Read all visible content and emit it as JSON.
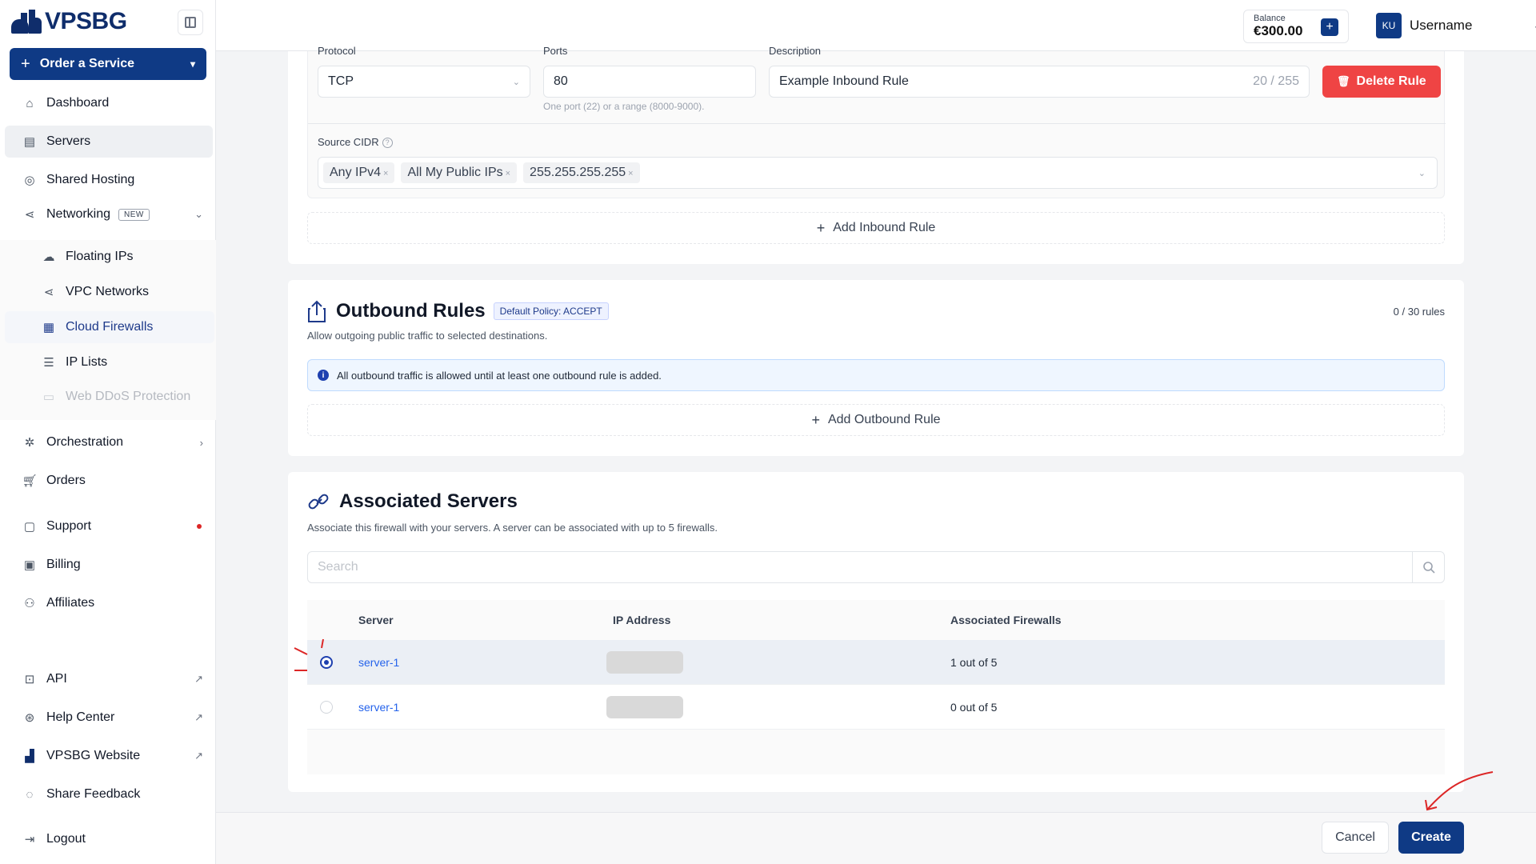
{
  "brand": {
    "name": "VPSBG"
  },
  "sidebar": {
    "order_label": "Order a Service",
    "items": [
      {
        "label": "Dashboard",
        "icon": "home-icon"
      },
      {
        "label": "Servers",
        "icon": "server-icon",
        "active": true
      },
      {
        "label": "Shared Hosting",
        "icon": "globe-icon"
      },
      {
        "label": "Networking",
        "icon": "share-icon",
        "badge": "NEW"
      },
      {
        "label": "Floating IPs",
        "icon": "cloud-icon"
      },
      {
        "label": "VPC Networks",
        "icon": "share-icon"
      },
      {
        "label": "Cloud Firewalls",
        "icon": "firewall-icon",
        "active": true
      },
      {
        "label": "IP Lists",
        "icon": "list-icon"
      },
      {
        "label": "Web DDoS Protection",
        "icon": "window-icon",
        "disabled": true
      },
      {
        "label": "Orchestration",
        "icon": "orchestration-icon"
      },
      {
        "label": "Orders",
        "icon": "cart-icon"
      },
      {
        "label": "Support",
        "icon": "chat-icon"
      },
      {
        "label": "Billing",
        "icon": "billing-icon"
      },
      {
        "label": "Affiliates",
        "icon": "users-icon"
      },
      {
        "label": "API",
        "icon": "code-icon"
      },
      {
        "label": "Help Center",
        "icon": "lifebuoy-icon"
      },
      {
        "label": "VPSBG Website",
        "icon": "logo-icon"
      },
      {
        "label": "Share Feedback",
        "icon": "feedback-icon"
      },
      {
        "label": "Logout",
        "icon": "logout-icon"
      }
    ]
  },
  "topbar": {
    "balance_label": "Balance",
    "balance_value": "€300.00",
    "avatar_initials": "KU",
    "username": "Username"
  },
  "inbound_rule": {
    "protocol_label": "Protocol",
    "protocol_value": "TCP",
    "ports_label": "Ports",
    "ports_value": "80",
    "ports_hint": "One port (22) or a range (8000-9000).",
    "description_label": "Description",
    "description_value": "Example Inbound Rule",
    "description_count": "20 / 255",
    "delete_label": "Delete Rule",
    "source_label": "Source CIDR",
    "source_tags": [
      "Any IPv4",
      "All My Public IPs",
      "255.255.255.255"
    ],
    "add_label": "Add Inbound Rule"
  },
  "outbound": {
    "title": "Outbound Rules",
    "policy": "Default Policy: ACCEPT",
    "count": "0 / 30 rules",
    "description": "Allow outgoing public traffic to selected destinations.",
    "info": "All outbound traffic is allowed until at least one outbound rule is added.",
    "add_label": "Add Outbound Rule"
  },
  "associated": {
    "title": "Associated Servers",
    "description": "Associate this firewall with your servers. A server can be associated with up to 5 firewalls.",
    "search_placeholder": "Search",
    "columns": [
      "Server",
      "IP Address",
      "Associated Firewalls"
    ],
    "rows": [
      {
        "server": "server-1",
        "firewalls": "1 out of 5",
        "selected": true
      },
      {
        "server": "server-1",
        "firewalls": "0 out of 5",
        "selected": false
      }
    ]
  },
  "actions": {
    "cancel": "Cancel",
    "create": "Create"
  },
  "colors": {
    "primary": "#0f3a85",
    "danger": "#ef4444",
    "link": "#2563eb",
    "annotation": "#dc2626"
  }
}
